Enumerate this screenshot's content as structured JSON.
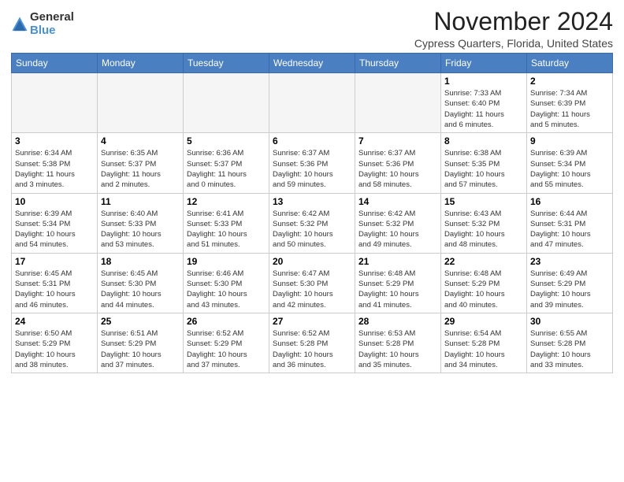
{
  "logo": {
    "general": "General",
    "blue": "Blue"
  },
  "title": "November 2024",
  "location": "Cypress Quarters, Florida, United States",
  "weekdays": [
    "Sunday",
    "Monday",
    "Tuesday",
    "Wednesday",
    "Thursday",
    "Friday",
    "Saturday"
  ],
  "weeks": [
    [
      {
        "day": "",
        "info": ""
      },
      {
        "day": "",
        "info": ""
      },
      {
        "day": "",
        "info": ""
      },
      {
        "day": "",
        "info": ""
      },
      {
        "day": "",
        "info": ""
      },
      {
        "day": "1",
        "info": "Sunrise: 7:33 AM\nSunset: 6:40 PM\nDaylight: 11 hours\nand 6 minutes."
      },
      {
        "day": "2",
        "info": "Sunrise: 7:34 AM\nSunset: 6:39 PM\nDaylight: 11 hours\nand 5 minutes."
      }
    ],
    [
      {
        "day": "3",
        "info": "Sunrise: 6:34 AM\nSunset: 5:38 PM\nDaylight: 11 hours\nand 3 minutes."
      },
      {
        "day": "4",
        "info": "Sunrise: 6:35 AM\nSunset: 5:37 PM\nDaylight: 11 hours\nand 2 minutes."
      },
      {
        "day": "5",
        "info": "Sunrise: 6:36 AM\nSunset: 5:37 PM\nDaylight: 11 hours\nand 0 minutes."
      },
      {
        "day": "6",
        "info": "Sunrise: 6:37 AM\nSunset: 5:36 PM\nDaylight: 10 hours\nand 59 minutes."
      },
      {
        "day": "7",
        "info": "Sunrise: 6:37 AM\nSunset: 5:36 PM\nDaylight: 10 hours\nand 58 minutes."
      },
      {
        "day": "8",
        "info": "Sunrise: 6:38 AM\nSunset: 5:35 PM\nDaylight: 10 hours\nand 57 minutes."
      },
      {
        "day": "9",
        "info": "Sunrise: 6:39 AM\nSunset: 5:34 PM\nDaylight: 10 hours\nand 55 minutes."
      }
    ],
    [
      {
        "day": "10",
        "info": "Sunrise: 6:39 AM\nSunset: 5:34 PM\nDaylight: 10 hours\nand 54 minutes."
      },
      {
        "day": "11",
        "info": "Sunrise: 6:40 AM\nSunset: 5:33 PM\nDaylight: 10 hours\nand 53 minutes."
      },
      {
        "day": "12",
        "info": "Sunrise: 6:41 AM\nSunset: 5:33 PM\nDaylight: 10 hours\nand 51 minutes."
      },
      {
        "day": "13",
        "info": "Sunrise: 6:42 AM\nSunset: 5:32 PM\nDaylight: 10 hours\nand 50 minutes."
      },
      {
        "day": "14",
        "info": "Sunrise: 6:42 AM\nSunset: 5:32 PM\nDaylight: 10 hours\nand 49 minutes."
      },
      {
        "day": "15",
        "info": "Sunrise: 6:43 AM\nSunset: 5:32 PM\nDaylight: 10 hours\nand 48 minutes."
      },
      {
        "day": "16",
        "info": "Sunrise: 6:44 AM\nSunset: 5:31 PM\nDaylight: 10 hours\nand 47 minutes."
      }
    ],
    [
      {
        "day": "17",
        "info": "Sunrise: 6:45 AM\nSunset: 5:31 PM\nDaylight: 10 hours\nand 46 minutes."
      },
      {
        "day": "18",
        "info": "Sunrise: 6:45 AM\nSunset: 5:30 PM\nDaylight: 10 hours\nand 44 minutes."
      },
      {
        "day": "19",
        "info": "Sunrise: 6:46 AM\nSunset: 5:30 PM\nDaylight: 10 hours\nand 43 minutes."
      },
      {
        "day": "20",
        "info": "Sunrise: 6:47 AM\nSunset: 5:30 PM\nDaylight: 10 hours\nand 42 minutes."
      },
      {
        "day": "21",
        "info": "Sunrise: 6:48 AM\nSunset: 5:29 PM\nDaylight: 10 hours\nand 41 minutes."
      },
      {
        "day": "22",
        "info": "Sunrise: 6:48 AM\nSunset: 5:29 PM\nDaylight: 10 hours\nand 40 minutes."
      },
      {
        "day": "23",
        "info": "Sunrise: 6:49 AM\nSunset: 5:29 PM\nDaylight: 10 hours\nand 39 minutes."
      }
    ],
    [
      {
        "day": "24",
        "info": "Sunrise: 6:50 AM\nSunset: 5:29 PM\nDaylight: 10 hours\nand 38 minutes."
      },
      {
        "day": "25",
        "info": "Sunrise: 6:51 AM\nSunset: 5:29 PM\nDaylight: 10 hours\nand 37 minutes."
      },
      {
        "day": "26",
        "info": "Sunrise: 6:52 AM\nSunset: 5:29 PM\nDaylight: 10 hours\nand 37 minutes."
      },
      {
        "day": "27",
        "info": "Sunrise: 6:52 AM\nSunset: 5:28 PM\nDaylight: 10 hours\nand 36 minutes."
      },
      {
        "day": "28",
        "info": "Sunrise: 6:53 AM\nSunset: 5:28 PM\nDaylight: 10 hours\nand 35 minutes."
      },
      {
        "day": "29",
        "info": "Sunrise: 6:54 AM\nSunset: 5:28 PM\nDaylight: 10 hours\nand 34 minutes."
      },
      {
        "day": "30",
        "info": "Sunrise: 6:55 AM\nSunset: 5:28 PM\nDaylight: 10 hours\nand 33 minutes."
      }
    ]
  ]
}
